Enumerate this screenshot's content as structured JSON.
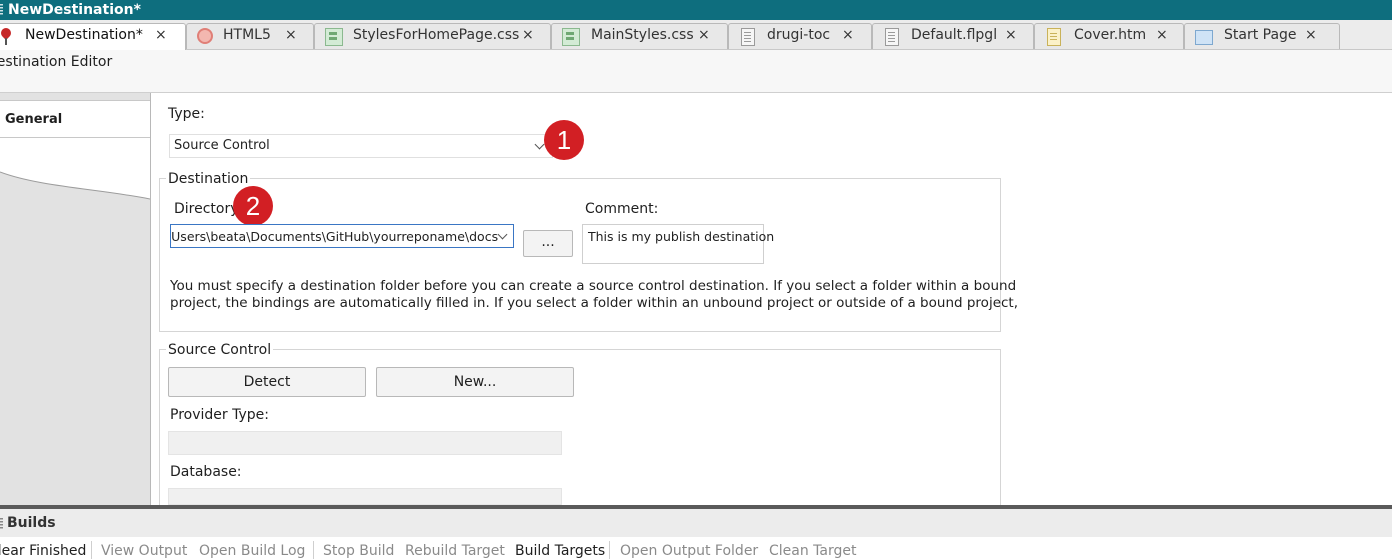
{
  "window": {
    "title": "NewDestination*"
  },
  "tabs": [
    {
      "label": "NewDestination*",
      "icon": "map-pin-icon",
      "active": true
    },
    {
      "label": "HTML5",
      "icon": "html5-target-icon"
    },
    {
      "label": "StylesForHomePage.css",
      "icon": "stylesheet-icon"
    },
    {
      "label": "MainStyles.css",
      "icon": "stylesheet-icon"
    },
    {
      "label": "drugi-toc",
      "icon": "toc-document-icon"
    },
    {
      "label": "Default.flpgl",
      "icon": "glossary-document-icon"
    },
    {
      "label": "Cover.htm",
      "icon": "htm-document-icon"
    },
    {
      "label": "Start Page",
      "icon": "start-page-icon"
    }
  ],
  "close_glyph": "×",
  "editor": {
    "title": "Destination Editor"
  },
  "nav": {
    "general": "General"
  },
  "form": {
    "type_label": "Type:",
    "type_value": "Source Control",
    "destination_group": "Destination",
    "directory_label": "Directory:",
    "directory_value": "C:\\Users\\beata\\Documents\\GitHub\\yourreponame\\docs",
    "browse_label": "...",
    "comment_label": "Comment:",
    "comment_value": "This is my publish destination",
    "help_line1": "You must specify a destination folder before you can create a source control destination. If you select a folder within a bound",
    "help_line2": "project, the bindings are automatically filled in. If you select a folder within an unbound project or outside of a bound project,",
    "source_control_group": "Source Control",
    "detect_label": "Detect",
    "new_label": "New...",
    "provider_type_label": "Provider Type:",
    "database_label": "Database:"
  },
  "callouts": [
    "1",
    "2"
  ],
  "builds": {
    "title": "Builds",
    "toolbar": [
      {
        "label": "Clear Finished",
        "enabled": true
      },
      {
        "label": "View Output",
        "enabled": false
      },
      {
        "label": "Open Build Log",
        "enabled": false
      },
      {
        "label": "Stop Build",
        "enabled": false
      },
      {
        "label": "Rebuild Target",
        "enabled": false
      },
      {
        "label": "Build Targets",
        "enabled": true
      },
      {
        "label": "Open Output Folder",
        "enabled": false
      },
      {
        "label": "Clean Target",
        "enabled": false
      }
    ]
  },
  "colors": {
    "titlebar": "#0e6e7e",
    "callout": "#d21f24"
  }
}
